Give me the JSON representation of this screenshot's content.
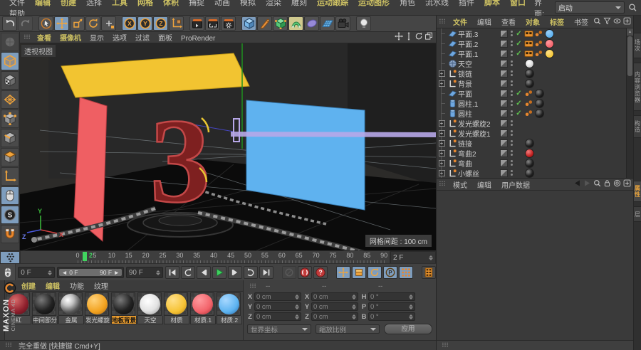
{
  "menu_bar": {
    "items": [
      {
        "label": "文件",
        "hl": false
      },
      {
        "label": "编辑",
        "hl": true
      },
      {
        "label": "创建",
        "hl": true
      },
      {
        "label": "选择",
        "hl": false
      },
      {
        "label": "工具",
        "hl": true
      },
      {
        "label": "网格",
        "hl": true
      },
      {
        "label": "体积",
        "hl": true
      },
      {
        "label": "捕捉",
        "hl": false
      },
      {
        "label": "动画",
        "hl": false
      },
      {
        "label": "模拟",
        "hl": false
      },
      {
        "label": "渲染",
        "hl": false
      },
      {
        "label": "雕刻",
        "hl": false
      },
      {
        "label": "运动跟踪",
        "hl": true
      },
      {
        "label": "运动图形",
        "hl": true
      },
      {
        "label": "角色",
        "hl": false
      },
      {
        "label": "流水线",
        "hl": false
      },
      {
        "label": "插件",
        "hl": false
      },
      {
        "label": "脚本",
        "hl": true
      },
      {
        "label": "窗口",
        "hl": true
      },
      {
        "label": "帮助",
        "hl": false
      }
    ],
    "interface_label": "界面:",
    "interface_value": "启动"
  },
  "toolbar": {
    "buttons": [
      {
        "icon": "undo-icon"
      },
      {
        "icon": "redo-icon",
        "state": "disabled"
      },
      {
        "sep": true
      },
      {
        "icon": "live-selection-icon"
      },
      {
        "icon": "move-icon",
        "state": "active"
      },
      {
        "icon": "scale-icon"
      },
      {
        "icon": "rotate-icon"
      },
      {
        "icon": "last-tool-icon"
      },
      {
        "sep": true
      },
      {
        "icon": "lock-x-icon",
        "state": "active"
      },
      {
        "icon": "lock-y-icon",
        "state": "active"
      },
      {
        "icon": "lock-z-icon",
        "state": "active"
      },
      {
        "icon": "coord-system-icon"
      },
      {
        "sep": true
      },
      {
        "icon": "render-view-icon"
      },
      {
        "icon": "render-region-icon"
      },
      {
        "icon": "render-settings-icon"
      },
      {
        "sep": true
      },
      {
        "icon": "add-cube-icon",
        "state": "active"
      },
      {
        "icon": "pen-icon"
      },
      {
        "icon": "subdivision-icon"
      },
      {
        "icon": "deformer-icon",
        "state": "activey"
      },
      {
        "icon": "spline-disc-icon"
      },
      {
        "icon": "floor-icon"
      },
      {
        "icon": "camera-icon"
      },
      {
        "sep": true
      },
      {
        "icon": "light-icon"
      }
    ]
  },
  "left_toolbar": {
    "tools": [
      {
        "icon": "make-editable-icon",
        "state": "disabled"
      },
      {
        "icon": "model-mode-icon",
        "state": "active"
      },
      {
        "icon": "texture-mode-icon"
      },
      {
        "icon": "workplane-icon"
      },
      {
        "icon": "points-mode-icon"
      },
      {
        "icon": "edges-mode-icon"
      },
      {
        "icon": "polygons-mode-icon"
      },
      {
        "icon": "axis-mode-icon"
      },
      {
        "icon": "tweak-mouse-icon",
        "state": "active"
      },
      {
        "icon": "snap-icon",
        "state": "active"
      },
      {
        "icon": "magnet-icon"
      }
    ]
  },
  "viewport": {
    "menu": [
      {
        "label": "查看",
        "hl": true
      },
      {
        "label": "摄像机",
        "hl": true
      },
      {
        "label": "显示",
        "hl": false
      },
      {
        "label": "选项",
        "hl": false
      },
      {
        "label": "过滤",
        "hl": false
      },
      {
        "label": "面板",
        "hl": false
      },
      {
        "label": "ProRender",
        "hl": false
      }
    ],
    "controls": [
      "pan-icon",
      "zoom-vert-icon",
      "orbit-icon",
      "maximize-icon"
    ],
    "view_label": "透视视图",
    "grid_label": "网格间距 : 100 cm",
    "axis": {
      "x": "X",
      "y": "Y",
      "z": "Z"
    }
  },
  "timeline": {
    "ticks": [
      0,
      5,
      10,
      15,
      20,
      25,
      30,
      35,
      40,
      45,
      50,
      55,
      60,
      65,
      70,
      75,
      80,
      85,
      90
    ],
    "playhead_frame": "2",
    "frame_field": "2 F"
  },
  "transport": {
    "current": "0 F",
    "range_start": "0 F",
    "range_end": "90 F",
    "end": "90 F",
    "buttons": [
      {
        "icon": "goto-start-icon"
      },
      {
        "icon": "loop-left-icon"
      },
      {
        "icon": "prev-frame-icon"
      },
      {
        "icon": "play-icon"
      },
      {
        "icon": "next-frame-icon"
      },
      {
        "icon": "loop-right-icon"
      },
      {
        "icon": "goto-end-icon"
      },
      {
        "gap": true
      },
      {
        "icon": "record-off-icon",
        "state": "disabled"
      },
      {
        "icon": "record-key-icon"
      },
      {
        "icon": "record-question-icon"
      },
      {
        "gap": true
      },
      {
        "icon": "key-pos-icon",
        "state": "active"
      },
      {
        "icon": "key-scale-icon",
        "state": "active"
      },
      {
        "icon": "key-rot-icon",
        "state": "active"
      },
      {
        "icon": "key-param-icon",
        "state": "active"
      },
      {
        "icon": "key-pla-icon",
        "state": "active"
      },
      {
        "gap": true
      },
      {
        "icon": "film-icon"
      }
    ]
  },
  "materials": {
    "menu": [
      {
        "label": "创建",
        "hl": true
      },
      {
        "label": "编辑",
        "hl": true
      },
      {
        "label": "功能",
        "hl": false
      },
      {
        "label": "纹理",
        "hl": false
      }
    ],
    "items": [
      {
        "name": "红",
        "kind": "red"
      },
      {
        "name": "中间部分",
        "kind": "black"
      },
      {
        "name": "金属",
        "kind": "chrome"
      },
      {
        "name": "发光螺旋",
        "kind": "orange"
      },
      {
        "name": "地板背景",
        "kind": "black",
        "selected": true
      },
      {
        "name": "天空",
        "kind": "white"
      },
      {
        "name": "材质",
        "kind": "yellow"
      },
      {
        "name": "材质.1",
        "kind": "salmon"
      },
      {
        "name": "材质.2",
        "kind": "blue"
      }
    ]
  },
  "coordinates": {
    "headers": [
      "--",
      "--",
      "--"
    ],
    "groups": [
      {
        "labels": [
          "X",
          "Y",
          "Z"
        ],
        "values": [
          "0 cm",
          "0 cm",
          "0 cm"
        ]
      },
      {
        "labels": [
          "X",
          "Y",
          "Z"
        ],
        "values": [
          "0 cm",
          "0 cm",
          "0 cm"
        ]
      },
      {
        "labels": [
          "H",
          "P",
          "B"
        ],
        "values": [
          "0 °",
          "0 °",
          "0 °"
        ]
      }
    ],
    "transform_dropdown": "世界坐标",
    "scale_dropdown": "缩放比例",
    "apply_label": "应用"
  },
  "object_manager": {
    "menu": [
      {
        "label": "文件",
        "hl": true
      },
      {
        "label": "编辑",
        "hl": false
      },
      {
        "label": "查看",
        "hl": false
      },
      {
        "label": "对象",
        "hl": true
      },
      {
        "label": "标签",
        "hl": true
      },
      {
        "label": "书签",
        "hl": false
      }
    ],
    "header_icons": [
      "search-icon",
      "filter-icon",
      "eye-icon",
      "plus-box-icon"
    ],
    "objects": [
      {
        "name": "平面.3",
        "icon": "plane",
        "expand": false,
        "check": true,
        "film": true,
        "phong": true,
        "mat": "blue-flat"
      },
      {
        "name": "平面.2",
        "icon": "plane",
        "expand": false,
        "check": true,
        "film": true,
        "phong": true,
        "mat": "red-flat"
      },
      {
        "name": "平面.1",
        "icon": "plane",
        "expand": false,
        "check": true,
        "film": true,
        "phong": true,
        "mat": "yellow-flat"
      },
      {
        "name": "天空",
        "icon": "sky",
        "expand": false,
        "check": false,
        "film": false,
        "phong": false,
        "mat": "white"
      },
      {
        "name": "锁链",
        "icon": "null",
        "expand": true,
        "check": false,
        "film": false,
        "phong": false,
        "mat": "black"
      },
      {
        "name": "背景",
        "icon": "null",
        "expand": true,
        "check": false,
        "film": false,
        "phong": false,
        "mat": "black"
      },
      {
        "name": "平面",
        "icon": "plane",
        "expand": false,
        "check": true,
        "film": false,
        "phong": true,
        "mat": "black"
      },
      {
        "name": "圆柱.1",
        "icon": "cylinder",
        "expand": false,
        "check": true,
        "film": false,
        "phong": true,
        "mat": "black"
      },
      {
        "name": "圆柱",
        "icon": "cylinder",
        "expand": false,
        "check": true,
        "film": false,
        "phong": true,
        "mat": "black"
      },
      {
        "name": "发光螺旋2",
        "icon": "null",
        "expand": true,
        "check": false,
        "film": false,
        "phong": false,
        "mat": null
      },
      {
        "name": "发光螺旋1",
        "icon": "null",
        "expand": true,
        "check": false,
        "film": false,
        "phong": false,
        "mat": null
      },
      {
        "name": "链接",
        "icon": "null",
        "expand": true,
        "check": false,
        "film": false,
        "phong": false,
        "mat": "black"
      },
      {
        "name": "弯曲2",
        "icon": "null",
        "expand": true,
        "check": false,
        "film": false,
        "phong": false,
        "mat": "redball"
      },
      {
        "name": "弯曲",
        "icon": "null",
        "expand": true,
        "check": false,
        "film": false,
        "phong": false,
        "mat": "black"
      },
      {
        "name": "小螺丝",
        "icon": "null",
        "expand": true,
        "check": false,
        "film": false,
        "phong": false,
        "mat": "black"
      }
    ]
  },
  "attribute_manager": {
    "menu": [
      {
        "label": "模式",
        "hl": false
      },
      {
        "label": "编辑",
        "hl": false
      },
      {
        "label": "用户数据",
        "hl": false
      }
    ],
    "header_icons": [
      "back-icon",
      "forward-icon",
      "search-icon",
      "lock-icon",
      "target-icon",
      "plus-box-icon"
    ]
  },
  "side_tabs": {
    "upper": [
      {
        "label": "场次"
      },
      {
        "label": "内容浏览器"
      },
      {
        "label": "构造"
      }
    ],
    "lower": [
      {
        "label": "属性",
        "active": true
      },
      {
        "label": "层"
      }
    ]
  },
  "status_bar": {
    "text": "完全重做 [快捷键 Cmd+Y]"
  },
  "logo": {
    "maxon": "MAXON",
    "product": "CINEMA 4D"
  }
}
